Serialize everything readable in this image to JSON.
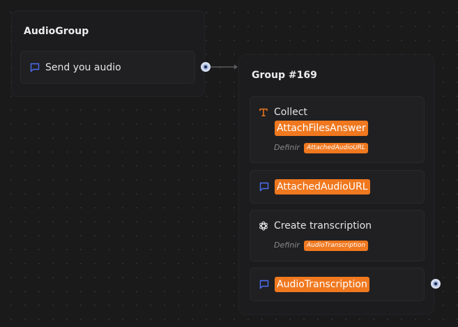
{
  "canvas": {
    "background": "#1a1a1b",
    "accent_orange": "#f0781f",
    "accent_blue": "#4c6ef5",
    "handle_color": "#9fb1d8"
  },
  "group_audio": {
    "title": "AudioGroup",
    "blocks": [
      {
        "icon": "chat-bubble-icon",
        "text": "Send you audio"
      }
    ]
  },
  "group_169": {
    "title": "Group #169",
    "blocks": [
      {
        "icon": "text-t-icon",
        "label": "Collect",
        "variable": "AttachFilesAnswer",
        "set_label": "Definir",
        "set_variable": "AttachedAudioURL"
      },
      {
        "icon": "chat-bubble-icon",
        "variable": "AttachedAudioURL"
      },
      {
        "icon": "openai-icon",
        "label": "Create transcription",
        "set_label": "Definir",
        "set_variable": "AudioTranscription"
      },
      {
        "icon": "chat-bubble-icon",
        "variable": "AudioTranscription"
      }
    ]
  }
}
